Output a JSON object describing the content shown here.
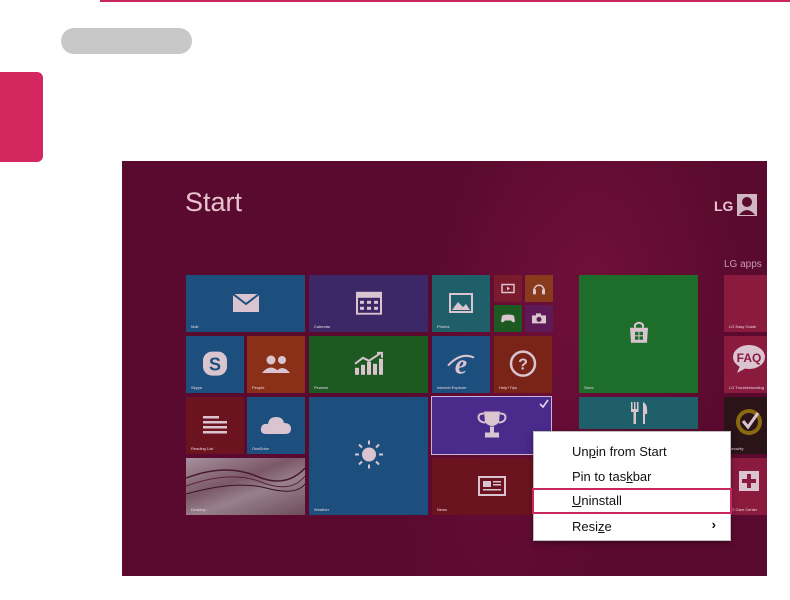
{
  "start": {
    "title": "Start",
    "user_name": "LG",
    "lg_apps_label": "LG apps"
  },
  "tiles": [
    {
      "label": "Mail",
      "icon": "mail-icon"
    },
    {
      "label": "Calendar",
      "icon": "calendar-icon"
    },
    {
      "label": "Photos",
      "icon": "photos-icon"
    },
    {
      "label": "",
      "icon": "video-icon"
    },
    {
      "label": "",
      "icon": "music-icon"
    },
    {
      "label": "",
      "icon": "games-icon"
    },
    {
      "label": "",
      "icon": "camera-icon"
    },
    {
      "label": "Store",
      "icon": "store-icon"
    },
    {
      "label": "Skype",
      "icon": "skype-icon"
    },
    {
      "label": "People",
      "icon": "people-icon"
    },
    {
      "label": "Finance",
      "icon": "finance-icon"
    },
    {
      "label": "Internet Explorer",
      "icon": "ie-icon"
    },
    {
      "label": "Help+Tips",
      "icon": "help-icon"
    },
    {
      "label": "Reading List",
      "icon": "reading-list-icon"
    },
    {
      "label": "OneDrive",
      "icon": "cloud-icon"
    },
    {
      "label": "Weather",
      "icon": "weather-icon"
    },
    {
      "label": "",
      "icon": "trophy-icon"
    },
    {
      "label": "",
      "icon": "food-icon"
    },
    {
      "label": "Desktop",
      "icon": ""
    },
    {
      "label": "News",
      "icon": "news-icon"
    },
    {
      "label": "LG Easy Guide",
      "icon": ""
    },
    {
      "label": "LG Troubleshooting",
      "icon": "faq-icon"
    },
    {
      "label": "Security",
      "icon": "security-icon"
    },
    {
      "label": "LG Care Center",
      "icon": "care-icon"
    }
  ],
  "context_menu": {
    "items": [
      {
        "pre": "Un",
        "u": "p",
        "post": "in from Start"
      },
      {
        "pre": "Pin to tas",
        "u": "k",
        "post": "bar"
      },
      {
        "pre": "",
        "u": "U",
        "post": "ninstall"
      },
      {
        "pre": "Resi",
        "u": "z",
        "post": "e"
      }
    ],
    "submenu_arrow": "›",
    "highlighted_index": 2
  },
  "colors": {
    "accent": "#c8285f",
    "overlay_bg": "#5a0a2e"
  }
}
